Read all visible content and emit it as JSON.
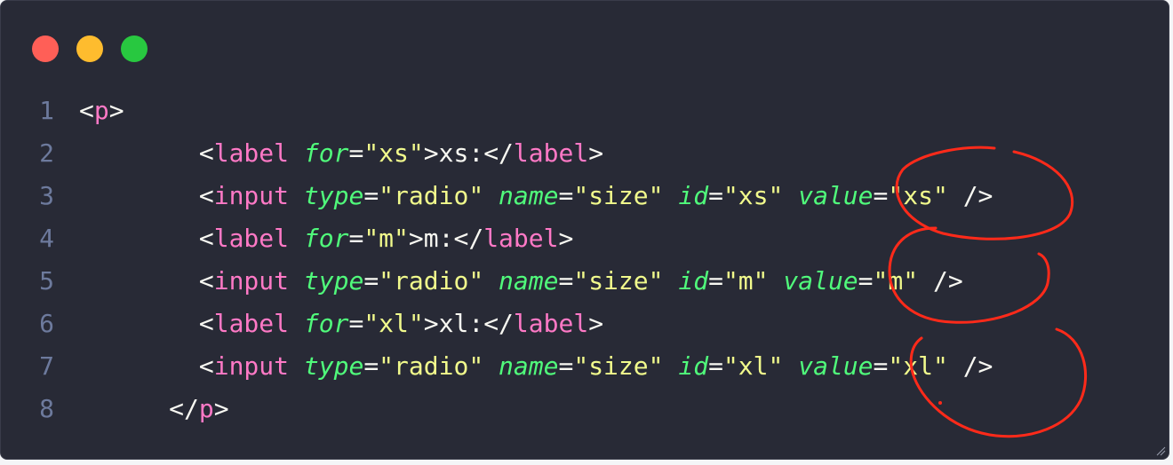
{
  "window": {
    "dot_colors": {
      "close": "#ff5f57",
      "minimize": "#febc2e",
      "maximize": "#28c840"
    }
  },
  "code": {
    "lines": [
      {
        "num": "1",
        "tokens": [
          "<",
          "p",
          ">"
        ]
      },
      {
        "num": "2",
        "indent": "        ",
        "tokens": [
          "<",
          "label",
          " ",
          "for",
          "=",
          "\"xs\"",
          ">",
          "xs:",
          "</",
          "label",
          ">"
        ]
      },
      {
        "num": "3",
        "indent": "        ",
        "tokens": [
          "<",
          "input",
          " ",
          "type",
          "=",
          "\"radio\"",
          " ",
          "name",
          "=",
          "\"size\"",
          " ",
          "id",
          "=",
          "\"xs\"",
          " ",
          "value",
          "=",
          "\"xs\"",
          " ",
          "/>"
        ]
      },
      {
        "num": "4",
        "indent": "        ",
        "tokens": [
          "<",
          "label",
          " ",
          "for",
          "=",
          "\"m\"",
          ">",
          "m:",
          "</",
          "label",
          ">"
        ]
      },
      {
        "num": "5",
        "indent": "        ",
        "tokens": [
          "<",
          "input",
          " ",
          "type",
          "=",
          "\"radio\"",
          " ",
          "name",
          "=",
          "\"size\"",
          " ",
          "id",
          "=",
          "\"m\"",
          " ",
          "value",
          "=",
          "\"m\"",
          " ",
          "/>"
        ]
      },
      {
        "num": "6",
        "indent": "        ",
        "tokens": [
          "<",
          "label",
          " ",
          "for",
          "=",
          "\"xl\"",
          ">",
          "xl:",
          "</",
          "label",
          ">"
        ]
      },
      {
        "num": "7",
        "indent": "        ",
        "tokens": [
          "<",
          "input",
          " ",
          "type",
          "=",
          "\"radio\"",
          " ",
          "name",
          "=",
          "\"size\"",
          " ",
          "id",
          "=",
          "\"xl\"",
          " ",
          "value",
          "=",
          "\"xl\"",
          " ",
          "/>"
        ]
      },
      {
        "num": "8",
        "indent": "      ",
        "tokens": [
          "</",
          "p",
          ">"
        ]
      }
    ]
  },
  "colors": {
    "background": "#282a36",
    "line_number": "#6d7a9d",
    "tag": "#ff79c6",
    "attribute": "#50fa7b",
    "string": "#f1fa8c",
    "text": "#f8f8f2",
    "annotation": "#ff2a1a"
  }
}
